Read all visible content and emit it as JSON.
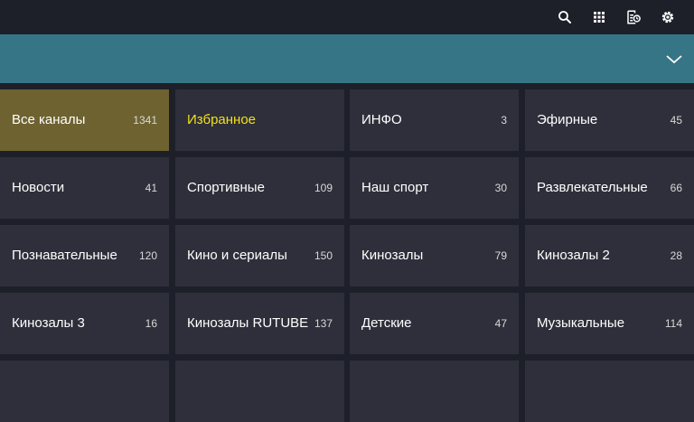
{
  "header": {
    "icons": [
      {
        "name": "search-icon"
      },
      {
        "name": "apps-grid-icon"
      },
      {
        "name": "tv-guide-icon"
      },
      {
        "name": "settings-gear-icon"
      }
    ]
  },
  "banner": {
    "expand_icon": "chevron-down-icon",
    "color": "#367585"
  },
  "colors": {
    "selected_tile": "#6e6230",
    "tile": "#2e2f3a",
    "favorite_text": "#f2e11a",
    "background": "#1d1f29"
  },
  "categories": [
    {
      "name": "Все каналы",
      "count": "1341",
      "selected": true
    },
    {
      "name": "Избранное",
      "count": "",
      "favorite": true
    },
    {
      "name": "ИНФО",
      "count": "3"
    },
    {
      "name": "Эфирные",
      "count": "45"
    },
    {
      "name": "Новости",
      "count": "41"
    },
    {
      "name": "Спортивные",
      "count": "109"
    },
    {
      "name": "Наш спорт",
      "count": "30"
    },
    {
      "name": "Развлекательные",
      "count": "66"
    },
    {
      "name": "Познавательные",
      "count": "120"
    },
    {
      "name": "Кино и сериалы",
      "count": "150"
    },
    {
      "name": "Кинозалы",
      "count": "79"
    },
    {
      "name": "Кинозалы 2",
      "count": "28"
    },
    {
      "name": "Кинозалы 3",
      "count": "16"
    },
    {
      "name": "Кинозалы RUTUBE",
      "count": "137"
    },
    {
      "name": "Детские",
      "count": "47"
    },
    {
      "name": "Музыкальные",
      "count": "114"
    },
    {
      "name": "",
      "count": ""
    },
    {
      "name": "",
      "count": ""
    },
    {
      "name": "",
      "count": ""
    },
    {
      "name": "",
      "count": ""
    }
  ]
}
